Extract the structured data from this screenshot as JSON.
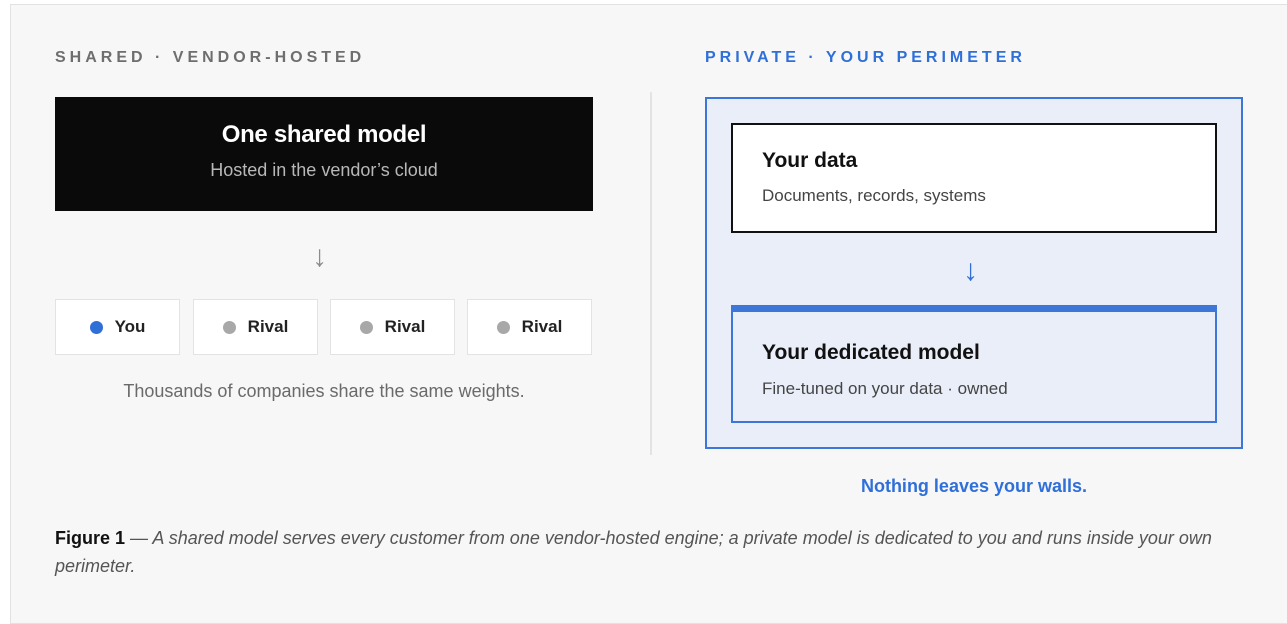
{
  "shared": {
    "heading": "SHARED · VENDOR-HOSTED",
    "model_title": "One shared model",
    "model_subtitle": "Hosted in the vendor’s cloud",
    "arrow": "↓",
    "customers": [
      {
        "label": "You",
        "dot_color": "#2f6fd8"
      },
      {
        "label": "Rival",
        "dot_color": "#a8a8a8"
      },
      {
        "label": "Rival",
        "dot_color": "#a8a8a8"
      },
      {
        "label": "Rival",
        "dot_color": "#a8a8a8"
      }
    ],
    "caption": "Thousands of companies share the same weights."
  },
  "private": {
    "heading": "PRIVATE · YOUR PERIMETER",
    "data_title": "Your data",
    "data_subtitle": "Documents, records, systems",
    "arrow": "↓",
    "model_title": "Your dedicated model",
    "model_subtitle": "Fine-tuned on your data · owned",
    "caption": "Nothing leaves your walls."
  },
  "figure": {
    "label": "Figure 1",
    "text": " — A shared model serves every customer from one vendor-hosted engine; a private model is dedicated to you and runs inside your own perimeter."
  },
  "colors": {
    "accent": "#2f6fd8",
    "shared_box": "#0a0a0a",
    "perimeter_fill": "#e9eef9"
  }
}
